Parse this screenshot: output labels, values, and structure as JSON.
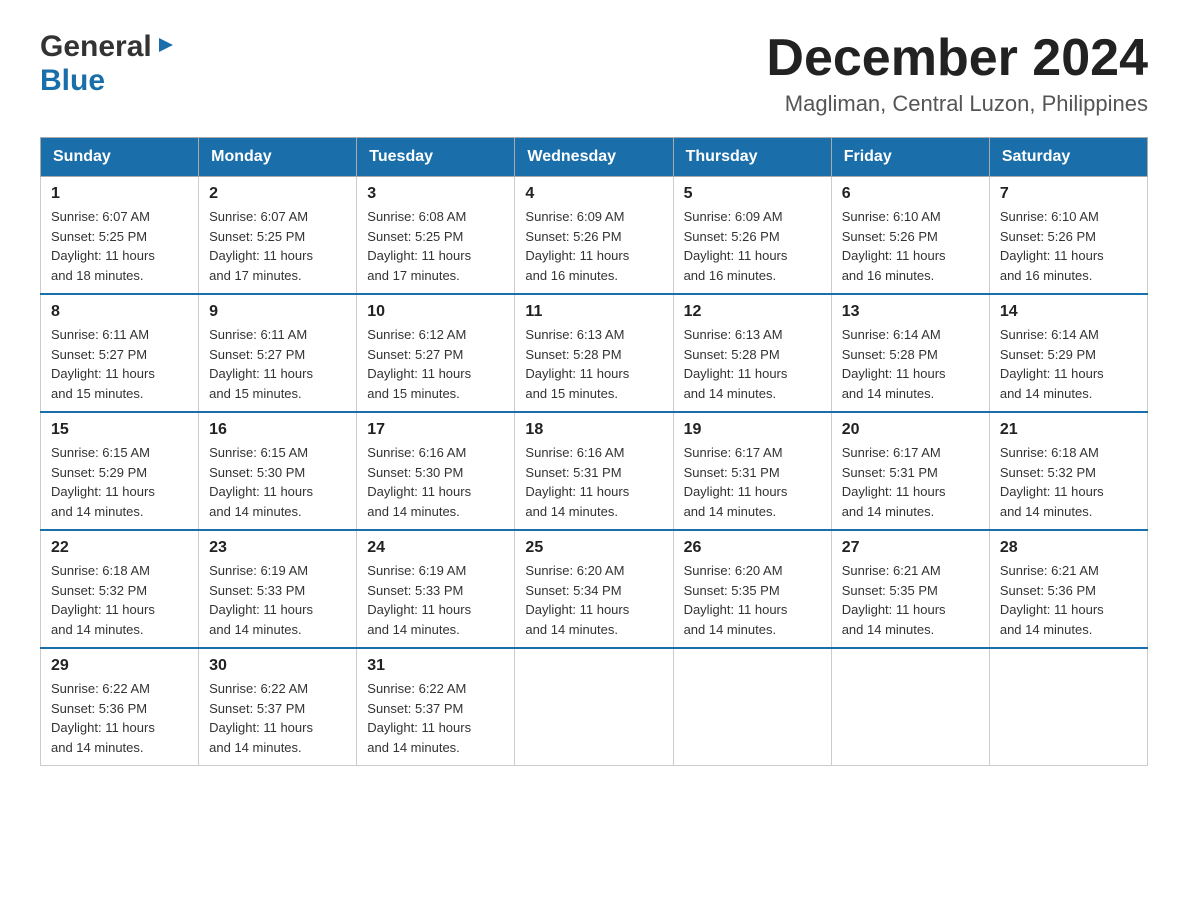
{
  "header": {
    "logo_general": "General",
    "logo_blue": "Blue",
    "title": "December 2024",
    "subtitle": "Magliman, Central Luzon, Philippines"
  },
  "calendar": {
    "days_of_week": [
      "Sunday",
      "Monday",
      "Tuesday",
      "Wednesday",
      "Thursday",
      "Friday",
      "Saturday"
    ],
    "weeks": [
      [
        {
          "day": "1",
          "sunrise": "6:07 AM",
          "sunset": "5:25 PM",
          "daylight": "11 hours and 18 minutes."
        },
        {
          "day": "2",
          "sunrise": "6:07 AM",
          "sunset": "5:25 PM",
          "daylight": "11 hours and 17 minutes."
        },
        {
          "day": "3",
          "sunrise": "6:08 AM",
          "sunset": "5:25 PM",
          "daylight": "11 hours and 17 minutes."
        },
        {
          "day": "4",
          "sunrise": "6:09 AM",
          "sunset": "5:26 PM",
          "daylight": "11 hours and 16 minutes."
        },
        {
          "day": "5",
          "sunrise": "6:09 AM",
          "sunset": "5:26 PM",
          "daylight": "11 hours and 16 minutes."
        },
        {
          "day": "6",
          "sunrise": "6:10 AM",
          "sunset": "5:26 PM",
          "daylight": "11 hours and 16 minutes."
        },
        {
          "day": "7",
          "sunrise": "6:10 AM",
          "sunset": "5:26 PM",
          "daylight": "11 hours and 16 minutes."
        }
      ],
      [
        {
          "day": "8",
          "sunrise": "6:11 AM",
          "sunset": "5:27 PM",
          "daylight": "11 hours and 15 minutes."
        },
        {
          "day": "9",
          "sunrise": "6:11 AM",
          "sunset": "5:27 PM",
          "daylight": "11 hours and 15 minutes."
        },
        {
          "day": "10",
          "sunrise": "6:12 AM",
          "sunset": "5:27 PM",
          "daylight": "11 hours and 15 minutes."
        },
        {
          "day": "11",
          "sunrise": "6:13 AM",
          "sunset": "5:28 PM",
          "daylight": "11 hours and 15 minutes."
        },
        {
          "day": "12",
          "sunrise": "6:13 AM",
          "sunset": "5:28 PM",
          "daylight": "11 hours and 14 minutes."
        },
        {
          "day": "13",
          "sunrise": "6:14 AM",
          "sunset": "5:28 PM",
          "daylight": "11 hours and 14 minutes."
        },
        {
          "day": "14",
          "sunrise": "6:14 AM",
          "sunset": "5:29 PM",
          "daylight": "11 hours and 14 minutes."
        }
      ],
      [
        {
          "day": "15",
          "sunrise": "6:15 AM",
          "sunset": "5:29 PM",
          "daylight": "11 hours and 14 minutes."
        },
        {
          "day": "16",
          "sunrise": "6:15 AM",
          "sunset": "5:30 PM",
          "daylight": "11 hours and 14 minutes."
        },
        {
          "day": "17",
          "sunrise": "6:16 AM",
          "sunset": "5:30 PM",
          "daylight": "11 hours and 14 minutes."
        },
        {
          "day": "18",
          "sunrise": "6:16 AM",
          "sunset": "5:31 PM",
          "daylight": "11 hours and 14 minutes."
        },
        {
          "day": "19",
          "sunrise": "6:17 AM",
          "sunset": "5:31 PM",
          "daylight": "11 hours and 14 minutes."
        },
        {
          "day": "20",
          "sunrise": "6:17 AM",
          "sunset": "5:31 PM",
          "daylight": "11 hours and 14 minutes."
        },
        {
          "day": "21",
          "sunrise": "6:18 AM",
          "sunset": "5:32 PM",
          "daylight": "11 hours and 14 minutes."
        }
      ],
      [
        {
          "day": "22",
          "sunrise": "6:18 AM",
          "sunset": "5:32 PM",
          "daylight": "11 hours and 14 minutes."
        },
        {
          "day": "23",
          "sunrise": "6:19 AM",
          "sunset": "5:33 PM",
          "daylight": "11 hours and 14 minutes."
        },
        {
          "day": "24",
          "sunrise": "6:19 AM",
          "sunset": "5:33 PM",
          "daylight": "11 hours and 14 minutes."
        },
        {
          "day": "25",
          "sunrise": "6:20 AM",
          "sunset": "5:34 PM",
          "daylight": "11 hours and 14 minutes."
        },
        {
          "day": "26",
          "sunrise": "6:20 AM",
          "sunset": "5:35 PM",
          "daylight": "11 hours and 14 minutes."
        },
        {
          "day": "27",
          "sunrise": "6:21 AM",
          "sunset": "5:35 PM",
          "daylight": "11 hours and 14 minutes."
        },
        {
          "day": "28",
          "sunrise": "6:21 AM",
          "sunset": "5:36 PM",
          "daylight": "11 hours and 14 minutes."
        }
      ],
      [
        {
          "day": "29",
          "sunrise": "6:22 AM",
          "sunset": "5:36 PM",
          "daylight": "11 hours and 14 minutes."
        },
        {
          "day": "30",
          "sunrise": "6:22 AM",
          "sunset": "5:37 PM",
          "daylight": "11 hours and 14 minutes."
        },
        {
          "day": "31",
          "sunrise": "6:22 AM",
          "sunset": "5:37 PM",
          "daylight": "11 hours and 14 minutes."
        },
        null,
        null,
        null,
        null
      ]
    ]
  }
}
